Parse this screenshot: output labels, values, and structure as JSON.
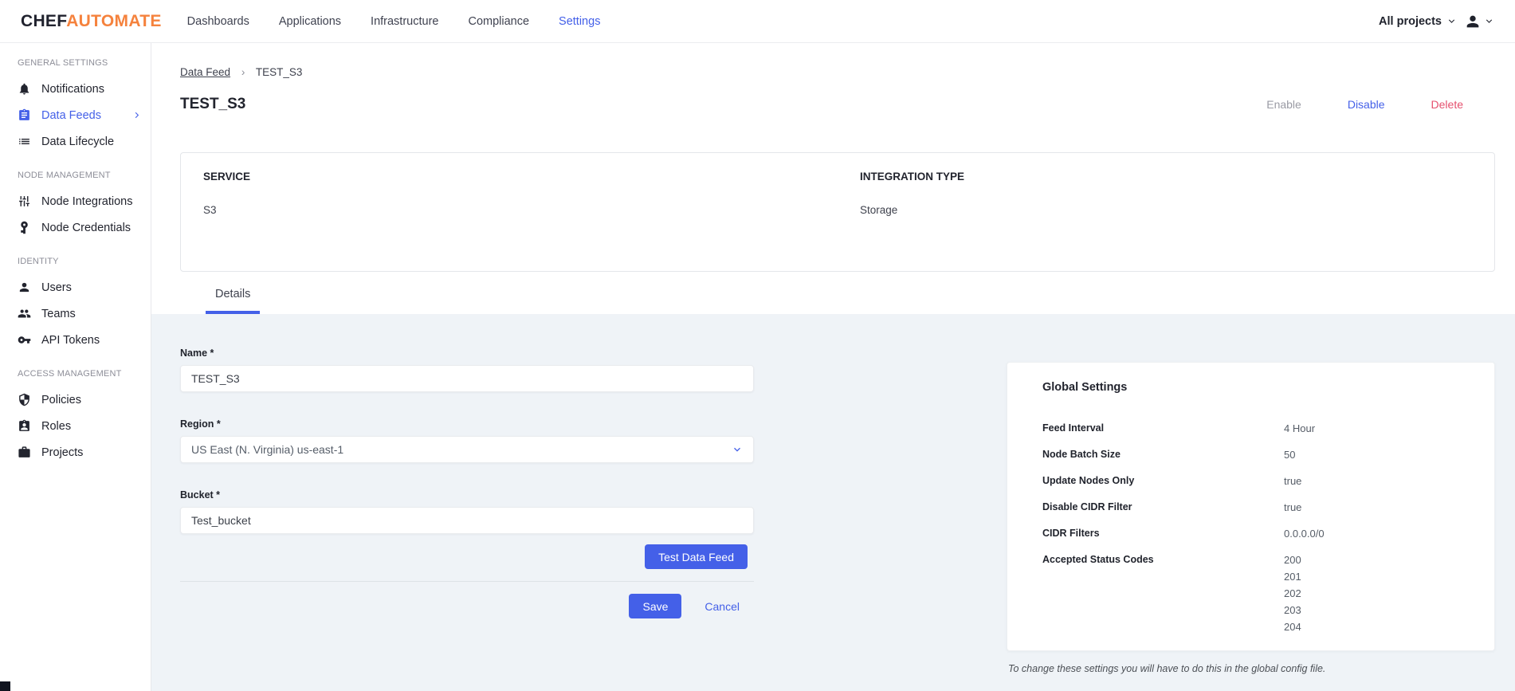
{
  "nav": {
    "logo_chef": "CHEF",
    "logo_automate": "AUTOMATE",
    "items": [
      {
        "label": "Dashboards"
      },
      {
        "label": "Applications"
      },
      {
        "label": "Infrastructure"
      },
      {
        "label": "Compliance"
      },
      {
        "label": "Settings"
      }
    ],
    "projects_filter": "All projects"
  },
  "sidebar": {
    "sections": [
      {
        "heading": "GENERAL SETTINGS",
        "items": [
          {
            "label": "Notifications",
            "icon": "bell-icon"
          },
          {
            "label": "Data Feeds",
            "icon": "data-feeds-icon",
            "active": true
          },
          {
            "label": "Data Lifecycle",
            "icon": "data-lifecycle-icon"
          }
        ]
      },
      {
        "heading": "NODE MANAGEMENT",
        "items": [
          {
            "label": "Node Integrations",
            "icon": "sliders-icon"
          },
          {
            "label": "Node Credentials",
            "icon": "key-icon"
          }
        ]
      },
      {
        "heading": "IDENTITY",
        "items": [
          {
            "label": "Users",
            "icon": "user-icon"
          },
          {
            "label": "Teams",
            "icon": "team-icon"
          },
          {
            "label": "API Tokens",
            "icon": "token-key-icon"
          }
        ]
      },
      {
        "heading": "ACCESS MANAGEMENT",
        "items": [
          {
            "label": "Policies",
            "icon": "shield-icon"
          },
          {
            "label": "Roles",
            "icon": "badge-icon"
          },
          {
            "label": "Projects",
            "icon": "briefcase-icon"
          }
        ]
      }
    ]
  },
  "main": {
    "breadcrumb": {
      "link": "Data Feed",
      "separator": "›",
      "current": "TEST_S3"
    },
    "title": "TEST_S3",
    "actions": {
      "enable": "Enable",
      "disable": "Disable",
      "delete": "Delete"
    },
    "info_card": {
      "service_label": "SERVICE",
      "service_value": "S3",
      "integration_label": "INTEGRATION TYPE",
      "integration_value": "Storage"
    },
    "tab": "Details",
    "form": {
      "name": {
        "label": "Name *",
        "value": "TEST_S3"
      },
      "region": {
        "label": "Region *",
        "value": "US East (N. Virginia) us-east-1"
      },
      "bucket": {
        "label": "Bucket *",
        "value": "Test_bucket"
      },
      "test_button": "Test Data Feed",
      "save_button": "Save",
      "cancel_link": "Cancel"
    },
    "global_settings": {
      "title": "Global Settings",
      "rows": [
        {
          "label": "Feed Interval",
          "values": [
            "4 Hour"
          ]
        },
        {
          "label": "Node Batch Size",
          "values": [
            "50"
          ]
        },
        {
          "label": "Update Nodes Only",
          "values": [
            "true"
          ]
        },
        {
          "label": "Disable CIDR Filter",
          "values": [
            "true"
          ]
        },
        {
          "label": "CIDR Filters",
          "values": [
            "0.0.0.0/0"
          ]
        },
        {
          "label": "Accepted Status Codes",
          "values": [
            "200",
            "201",
            "202",
            "203",
            "204"
          ]
        }
      ],
      "note": "To change these settings you will have to do this in the global config file."
    }
  },
  "colors": {
    "accent_blue": "#4460e8",
    "logo_orange": "#f5823d",
    "delete_red": "#e5506e",
    "enable_muted": "#9a9ba4",
    "page_background": "#eff3f7"
  }
}
